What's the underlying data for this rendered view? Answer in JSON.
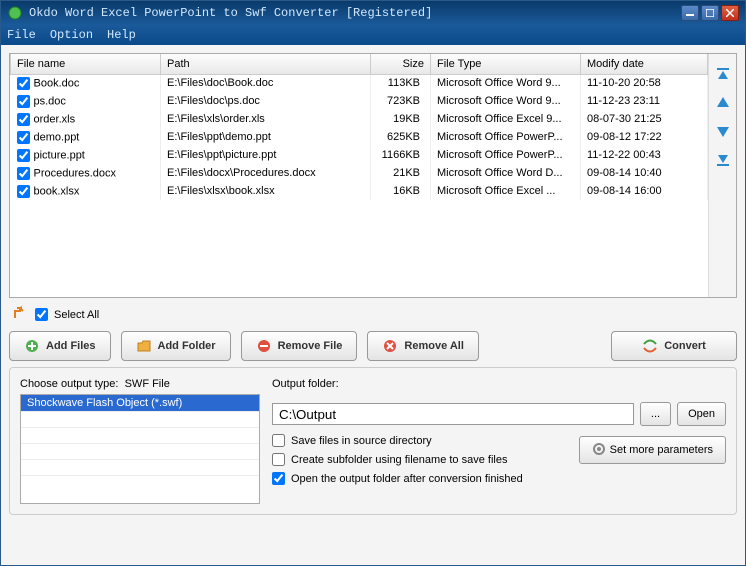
{
  "titlebar": {
    "title": "Okdo Word Excel PowerPoint to Swf Converter [Registered]"
  },
  "menu": {
    "file": "File",
    "option": "Option",
    "help": "Help"
  },
  "columns": {
    "name": "File name",
    "path": "Path",
    "size": "Size",
    "type": "File Type",
    "date": "Modify date"
  },
  "files": [
    {
      "name": "Book.doc",
      "path": "E:\\Files\\doc\\Book.doc",
      "size": "113KB",
      "type": "Microsoft Office Word 9...",
      "date": "11-10-20 20:58"
    },
    {
      "name": "ps.doc",
      "path": "E:\\Files\\doc\\ps.doc",
      "size": "723KB",
      "type": "Microsoft Office Word 9...",
      "date": "11-12-23 23:11"
    },
    {
      "name": "order.xls",
      "path": "E:\\Files\\xls\\order.xls",
      "size": "19KB",
      "type": "Microsoft Office Excel 9...",
      "date": "08-07-30 21:25"
    },
    {
      "name": "demo.ppt",
      "path": "E:\\Files\\ppt\\demo.ppt",
      "size": "625KB",
      "type": "Microsoft Office PowerP...",
      "date": "09-08-12 17:22"
    },
    {
      "name": "picture.ppt",
      "path": "E:\\Files\\ppt\\picture.ppt",
      "size": "1166KB",
      "type": "Microsoft Office PowerP...",
      "date": "11-12-22 00:43"
    },
    {
      "name": "Procedures.docx",
      "path": "E:\\Files\\docx\\Procedures.docx",
      "size": "21KB",
      "type": "Microsoft Office Word D...",
      "date": "09-08-14 10:40"
    },
    {
      "name": "book.xlsx",
      "path": "E:\\Files\\xlsx\\book.xlsx",
      "size": "16KB",
      "type": "Microsoft Office Excel ...",
      "date": "09-08-14 16:00"
    }
  ],
  "selectAll": "Select All",
  "buttons": {
    "addFiles": "Add Files",
    "addFolder": "Add Folder",
    "removeFile": "Remove File",
    "removeAll": "Remove All",
    "convert": "Convert",
    "browse": "...",
    "open": "Open",
    "params": "Set more parameters"
  },
  "output": {
    "typeLabel": "Choose output type:",
    "typeValue": "SWF File",
    "typeItem": "Shockwave Flash Object (*.swf)",
    "folderLabel": "Output folder:",
    "folderValue": "C:\\Output",
    "saveSource": "Save files in source directory",
    "createSub": "Create subfolder using filename to save files",
    "openAfter": "Open the output folder after conversion finished"
  }
}
